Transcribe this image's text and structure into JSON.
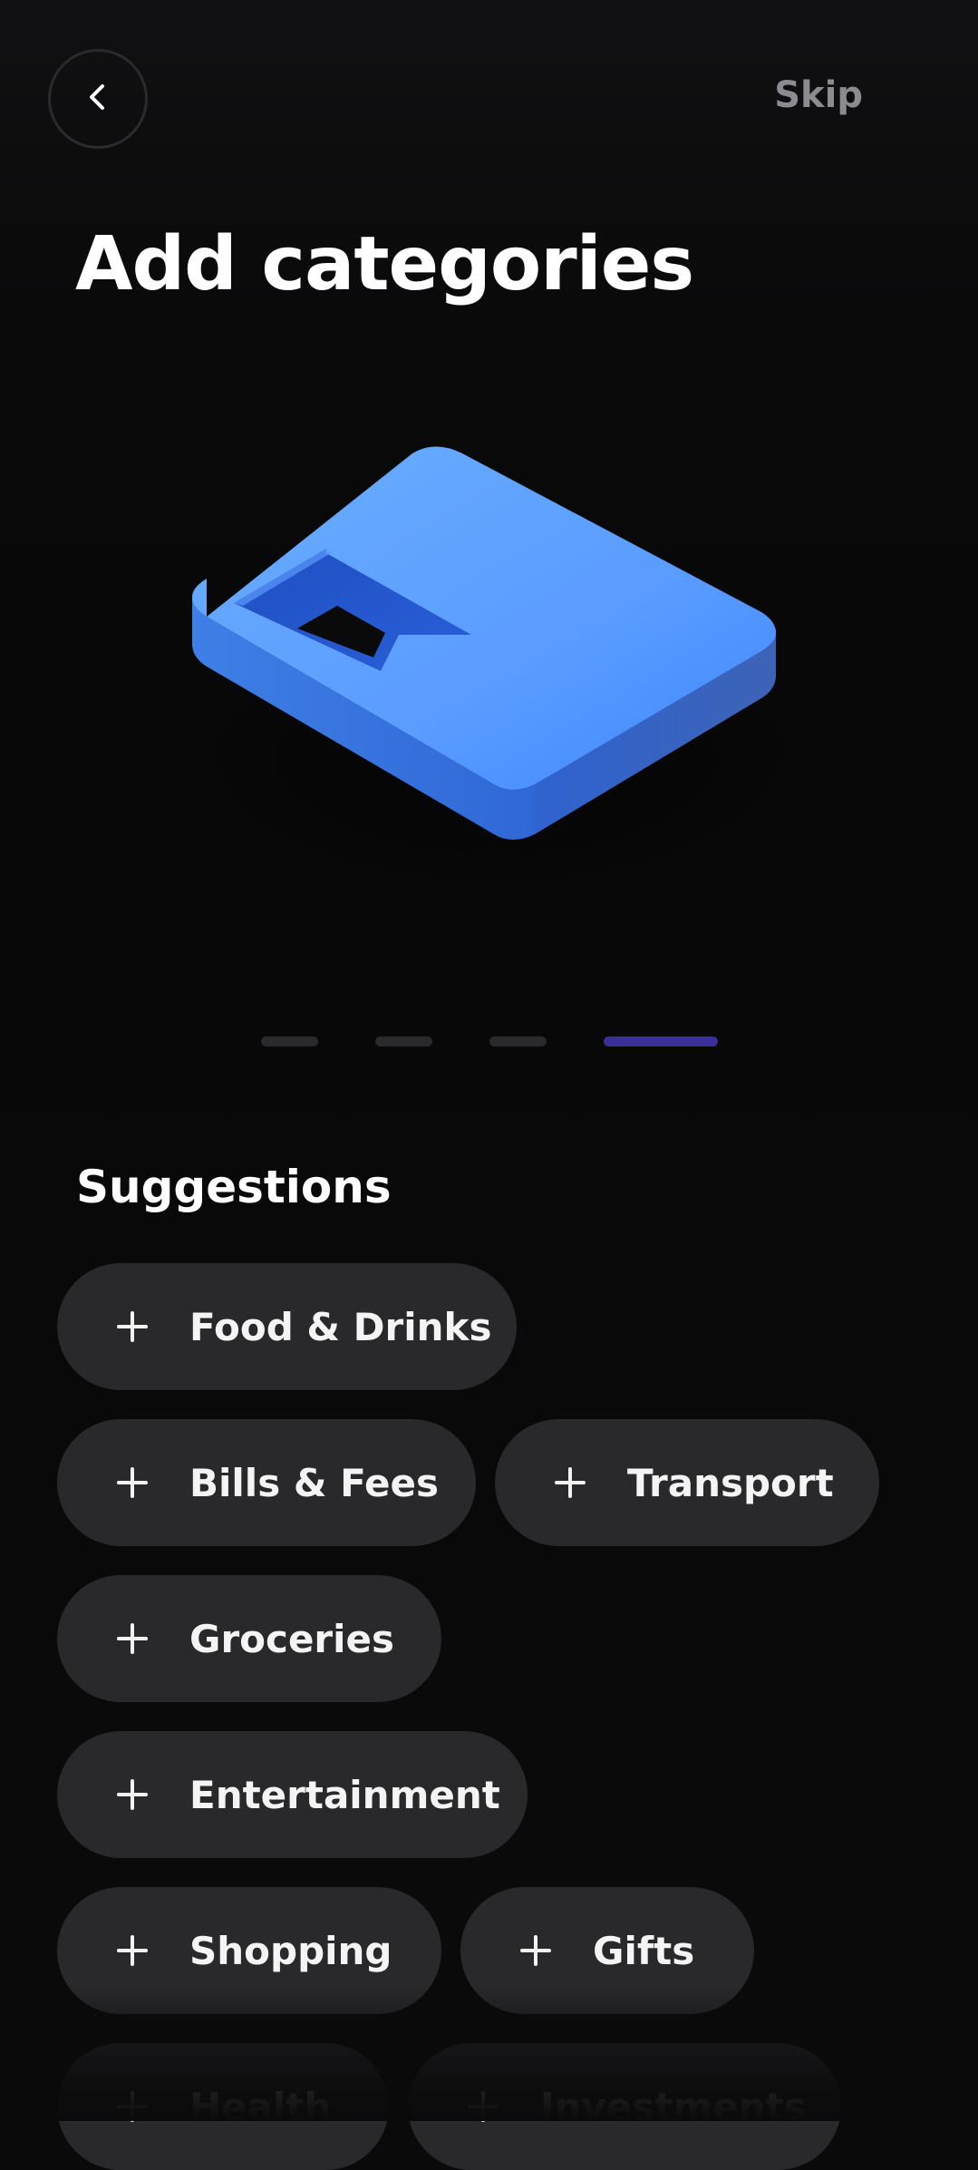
{
  "header": {
    "back_label": "",
    "skip_label": "Skip"
  },
  "title": "Add categories",
  "pagination": {
    "total": 4,
    "active_index": 3,
    "active_color": "#3a2f9a",
    "inactive_color": "#2a2a2d"
  },
  "illustration": {
    "icon": "folder-3d-icon",
    "color": "#3f86ff"
  },
  "suggestions": {
    "title": "Suggestions",
    "items": [
      {
        "label": "Food & Drinks"
      },
      {
        "label": "Bills & Fees"
      },
      {
        "label": "Transport"
      },
      {
        "label": "Groceries"
      },
      {
        "label": "Entertainment"
      },
      {
        "label": "Shopping"
      },
      {
        "label": "Gifts"
      },
      {
        "label": "Health"
      },
      {
        "label": "Investments"
      }
    ]
  },
  "colors": {
    "background": "#0a0a0b",
    "chip_background": "#29292c",
    "skip_text": "#8b8b90"
  }
}
